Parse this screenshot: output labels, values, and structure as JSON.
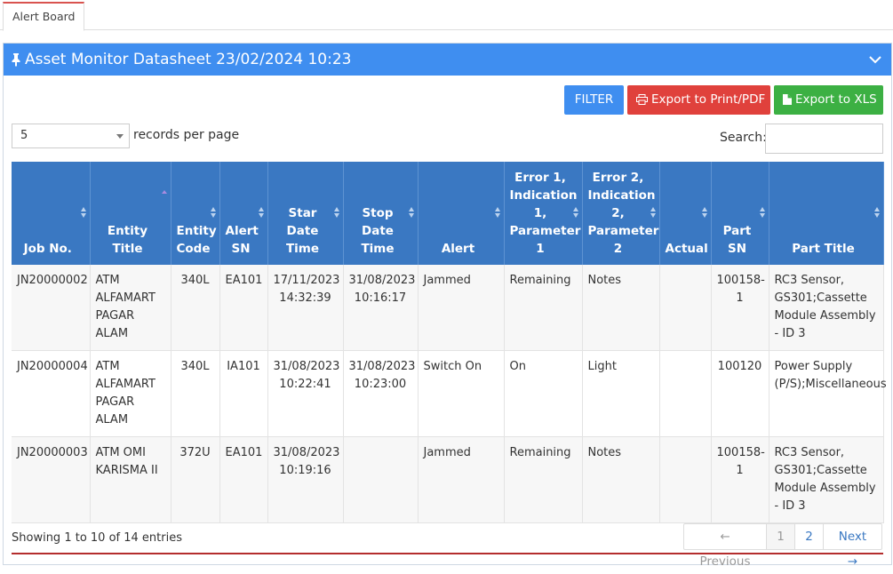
{
  "tabs": [
    {
      "label": "Alert Board",
      "active": true
    }
  ],
  "panel": {
    "title": "Asset Monitor Datasheet 23/02/2024 10:23",
    "pin_icon": "pin-icon",
    "collapse_icon": "chevron-down-icon",
    "header_color": "#3f8ef0"
  },
  "toolbar": {
    "filter_label": "FILTER",
    "pdf_label": "Export to Print/PDF",
    "pdf_icon": "print-icon",
    "xls_label": "Export to XLS",
    "xls_icon": "file-icon",
    "colors": {
      "filter": "#3f8ef0",
      "pdf": "#e0413c",
      "xls": "#3cb043"
    }
  },
  "records": {
    "selected": "5",
    "label": "records per page"
  },
  "search": {
    "label": "Search:",
    "value": "",
    "placeholder": ""
  },
  "table": {
    "columns": [
      "Job No.",
      "Entity Title",
      "Entity Code",
      "Alert SN",
      "Star Date Time",
      "Stop Date Time",
      "Alert",
      "Error 1, Indication 1, Parameter 1",
      "Error 2, Indication 2, Parameter 2",
      "Actual",
      "Part SN",
      "Part Title"
    ],
    "rows": [
      [
        "JN20000002",
        "ATM ALFAMART PAGAR ALAM",
        "340L",
        "EA101",
        "17/11/2023 14:32:39",
        "31/08/2023 10:16:17",
        "Jammed",
        "Remaining",
        "Notes",
        "",
        "100158-1",
        "RC3 Sensor, GS301;Cassette Module Assembly - ID 3"
      ],
      [
        "JN20000004",
        "ATM ALFAMART PAGAR ALAM",
        "340L",
        "IA101",
        "31/08/2023 10:22:41",
        "31/08/2023 10:23:00",
        "Switch On",
        "On",
        "Light",
        "",
        "100120",
        "Power Supply (P/S);Miscellaneous"
      ],
      [
        "JN20000003",
        "ATM OMI KARISMA II",
        "372U",
        "EA101",
        "31/08/2023 10:19:16",
        "",
        "Jammed",
        "Remaining",
        "Notes",
        "",
        "100158-1",
        "RC3 Sensor, GS301;Cassette Module Assembly - ID 3"
      ]
    ]
  },
  "footer": {
    "info": "Showing 1 to 10 of 14 entries",
    "prev": "← Previous",
    "pages": [
      "1",
      "2"
    ],
    "next": "Next →"
  }
}
